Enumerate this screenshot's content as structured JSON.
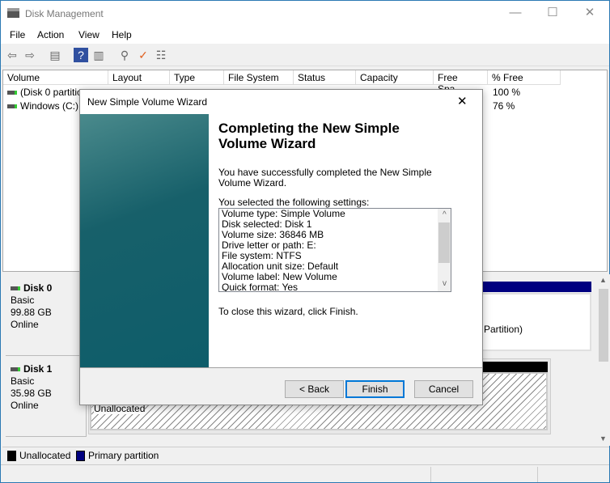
{
  "window": {
    "title": "Disk Management",
    "minimize": "—",
    "maximize": "☐",
    "close": "✕"
  },
  "menu": [
    "File",
    "Action",
    "View",
    "Help"
  ],
  "toolbar": [
    "back-icon",
    "forward-icon",
    "console-tree-icon",
    "help-icon",
    "action-pane-icon",
    "connect-icon",
    "check-icon",
    "properties-icon"
  ],
  "table": {
    "headers": [
      "Volume",
      "Layout",
      "Type",
      "File System",
      "Status",
      "Capacity",
      "Free Spa...",
      "% Free"
    ],
    "rows": [
      {
        "volume": "(Disk 0 partitio",
        "free_pct": "100 %"
      },
      {
        "volume": "Windows (C:)",
        "free_pct": "76 %"
      }
    ]
  },
  "disks": [
    {
      "name": "Disk 0",
      "type": "Basic",
      "size": "99.88 GB",
      "state": "Online",
      "partition_fragment": "Partition)"
    },
    {
      "name": "Disk 1",
      "type": "Basic",
      "size": "35.98 GB",
      "state": "Online",
      "partition_label": "Unallocated"
    }
  ],
  "legend": [
    {
      "label": "Unallocated",
      "color": "#000000"
    },
    {
      "label": "Primary partition",
      "color": "#000080"
    }
  ],
  "dialog": {
    "title": "New Simple Volume Wizard",
    "close": "✕",
    "heading": "Completing the New Simple Volume Wizard",
    "intro": "You have successfully completed the New Simple Volume Wizard.",
    "settings_label": "You selected the following settings:",
    "settings": [
      "Volume type: Simple Volume",
      "Disk selected: Disk 1",
      "Volume size: 36846 MB",
      "Drive letter or path: E:",
      "File system: NTFS",
      "Allocation unit size: Default",
      "Volume label: New Volume",
      "Quick format: Yes"
    ],
    "close_hint": "To close this wizard, click Finish.",
    "buttons": {
      "back": "< Back",
      "finish": "Finish",
      "cancel": "Cancel"
    }
  }
}
